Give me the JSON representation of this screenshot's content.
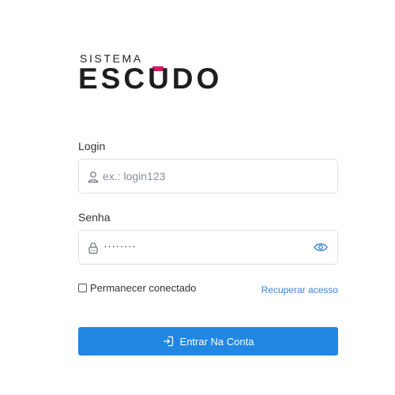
{
  "brand": {
    "top_word": "SISTEMA",
    "main_word": "ESCUDO",
    "accent_color": "#e0115f"
  },
  "login": {
    "label": "Login",
    "placeholder": "ex.: login123",
    "icon": "user-icon"
  },
  "password": {
    "label": "Senha",
    "masked_value": "········",
    "lock_icon": "lock-icon",
    "toggle_icon": "eye-icon"
  },
  "remember": {
    "label": "Permanecer conectado",
    "checked": false
  },
  "recover_link": "Recuperar acesso",
  "submit": {
    "label": "Entrar Na Conta",
    "icon": "sign-in-icon",
    "color": "#2187e3"
  }
}
